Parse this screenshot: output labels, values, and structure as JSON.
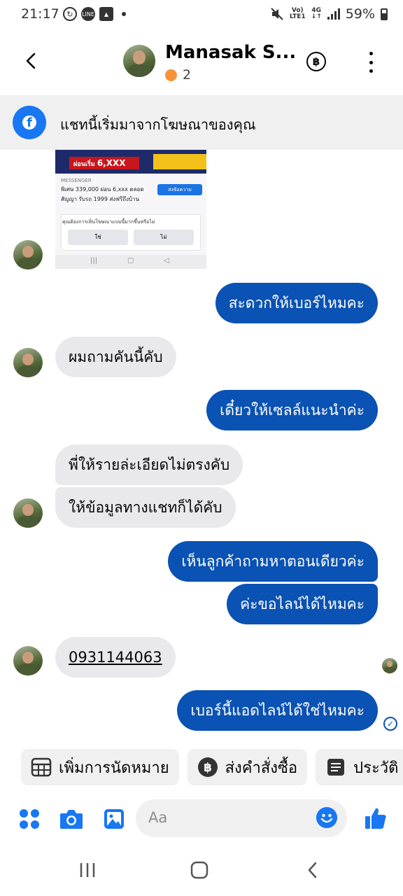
{
  "status_bar": {
    "time": "21:17",
    "network_top": "Vo)",
    "network_bottom": "LTE1",
    "network_type": "4G",
    "battery": "59%"
  },
  "header": {
    "contact_name": "Manasak S...",
    "badge_count": "2",
    "payment_symbol": "฿"
  },
  "banner": {
    "text": "แชทนี้เริ่มมาจากโฆษณาของคุณ"
  },
  "ad_preview": {
    "price_label": "ผ่อนเริ่ม",
    "price_value": "6,XXX",
    "source_label": "MESSENGER",
    "description": "พิเศษ 339,000 ผ่อน 6,xxx ตลอดสัญญา รับรถ 1999 ส่งฟรีถึงบ้าน",
    "send_button": "ส่งข้อความ",
    "question": "คุณต้องการเห็นโฆษณาแบบนี้มากขึ้นหรือไม่",
    "yes": "ใช่",
    "no": "ไม่"
  },
  "messages": [
    {
      "direction": "out",
      "text": "สะดวกให้เบอร์ไหมคะ"
    },
    {
      "direction": "in",
      "text": "ผมถามคันนี้คับ"
    },
    {
      "direction": "out",
      "text": "เดี๋ยวให้เซลล์แนะนำค่ะ"
    },
    {
      "direction": "in",
      "text": "พี่ให้รายล่ะเอียดไม่ตรงคับ"
    },
    {
      "direction": "in",
      "text": "ให้ข้อมูลทางแชทก็ได้คับ"
    },
    {
      "direction": "out",
      "text": "เห็นลูกค้าถามหาตอนเดียวค่ะ"
    },
    {
      "direction": "out",
      "text": "ค่ะขอไลน์ได้ไหมคะ"
    },
    {
      "direction": "in",
      "text": "0931144063"
    },
    {
      "direction": "out",
      "text": "เบอร์นี้แอดไลน์ได้ใช่ไหมคะ"
    }
  ],
  "quick_actions": [
    {
      "label": "เพิ่มการนัดหมาย",
      "icon": "calendar-icon"
    },
    {
      "label": "ส่งคำสั่งซื้อ",
      "icon": "baht-icon"
    },
    {
      "label": "ประวัติ",
      "icon": "receipt-icon"
    }
  ],
  "composer": {
    "placeholder": "Aa"
  },
  "colors": {
    "accent": "#1877f2",
    "outgoing_bubble": "#0a52b3",
    "incoming_bubble": "#e9e9eb",
    "banner_bg": "#f0f0f0"
  }
}
